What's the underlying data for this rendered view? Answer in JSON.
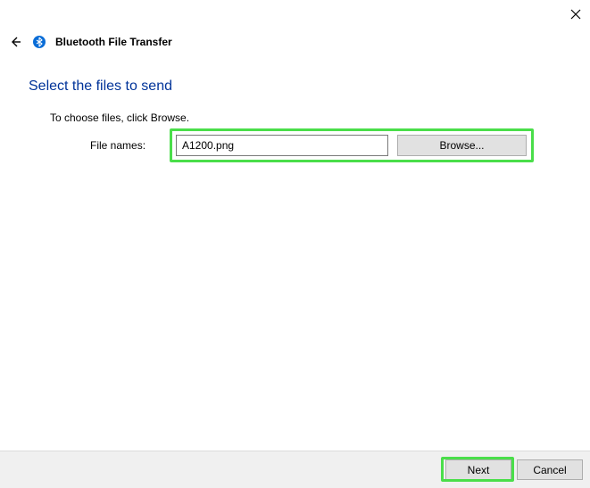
{
  "window": {
    "title": "Bluetooth File Transfer"
  },
  "page": {
    "heading": "Select the files to send",
    "instruction": "To choose files, click Browse.",
    "file_label": "File names:",
    "file_value": "A1200.png",
    "browse_label": "Browse..."
  },
  "buttons": {
    "next": "Next",
    "cancel": "Cancel"
  }
}
